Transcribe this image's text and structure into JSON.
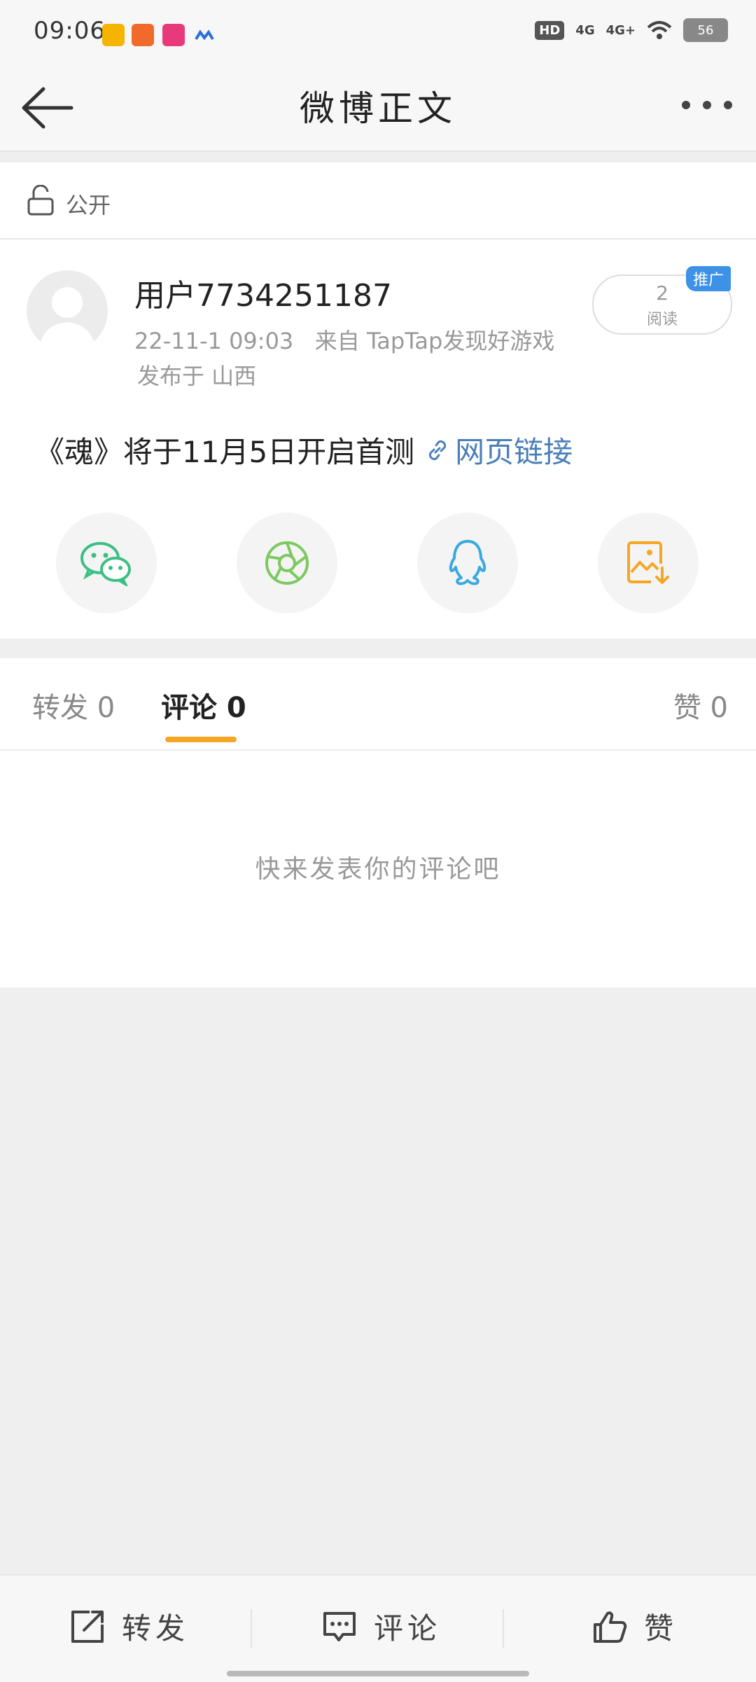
{
  "status_bar": {
    "time": "09:06",
    "network_hd": "HD",
    "network_1": "4G",
    "network_2": "4G+",
    "battery": "56"
  },
  "header": {
    "title": "微博正文"
  },
  "visibility": {
    "label": "公开"
  },
  "post": {
    "username": "用户7734251187",
    "timestamp": "22-11-1 09:03",
    "source": "来自 TapTap发现好游戏",
    "location": "发布于 山西",
    "read_count": "2",
    "read_label": "阅读",
    "promo_badge": "推广",
    "text": "《魂》将于11月5日开启首测",
    "link_label": "网页链接"
  },
  "tabs": {
    "repost": "转发 0",
    "comment": "评论 0",
    "like": "赞 0"
  },
  "comments": {
    "empty_text": "快来发表你的评论吧"
  },
  "bottom_bar": {
    "repost": "转发",
    "comment": "评论",
    "like": "赞"
  },
  "colors": {
    "accent_orange": "#f5a623",
    "link_blue": "#4a7fb8",
    "promo_blue": "#3d91e6",
    "wechat_green": "#3cbf84",
    "moments_green": "#7cc95f",
    "qq_blue": "#38a9e0",
    "save_orange": "#f5a623"
  }
}
